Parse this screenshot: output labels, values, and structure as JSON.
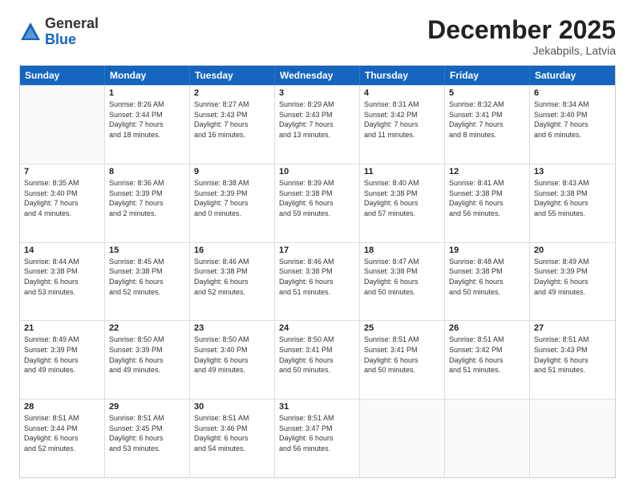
{
  "logo": {
    "general": "General",
    "blue": "Blue"
  },
  "title": "December 2025",
  "location": "Jekabpils, Latvia",
  "weekdays": [
    "Sunday",
    "Monday",
    "Tuesday",
    "Wednesday",
    "Thursday",
    "Friday",
    "Saturday"
  ],
  "rows": [
    [
      {
        "day": "",
        "lines": []
      },
      {
        "day": "1",
        "lines": [
          "Sunrise: 8:26 AM",
          "Sunset: 3:44 PM",
          "Daylight: 7 hours",
          "and 18 minutes."
        ]
      },
      {
        "day": "2",
        "lines": [
          "Sunrise: 8:27 AM",
          "Sunset: 3:43 PM",
          "Daylight: 7 hours",
          "and 16 minutes."
        ]
      },
      {
        "day": "3",
        "lines": [
          "Sunrise: 8:29 AM",
          "Sunset: 3:43 PM",
          "Daylight: 7 hours",
          "and 13 minutes."
        ]
      },
      {
        "day": "4",
        "lines": [
          "Sunrise: 8:31 AM",
          "Sunset: 3:42 PM",
          "Daylight: 7 hours",
          "and 11 minutes."
        ]
      },
      {
        "day": "5",
        "lines": [
          "Sunrise: 8:32 AM",
          "Sunset: 3:41 PM",
          "Daylight: 7 hours",
          "and 8 minutes."
        ]
      },
      {
        "day": "6",
        "lines": [
          "Sunrise: 8:34 AM",
          "Sunset: 3:40 PM",
          "Daylight: 7 hours",
          "and 6 minutes."
        ]
      }
    ],
    [
      {
        "day": "7",
        "lines": [
          "Sunrise: 8:35 AM",
          "Sunset: 3:40 PM",
          "Daylight: 7 hours",
          "and 4 minutes."
        ]
      },
      {
        "day": "8",
        "lines": [
          "Sunrise: 8:36 AM",
          "Sunset: 3:39 PM",
          "Daylight: 7 hours",
          "and 2 minutes."
        ]
      },
      {
        "day": "9",
        "lines": [
          "Sunrise: 8:38 AM",
          "Sunset: 3:39 PM",
          "Daylight: 7 hours",
          "and 0 minutes."
        ]
      },
      {
        "day": "10",
        "lines": [
          "Sunrise: 8:39 AM",
          "Sunset: 3:38 PM",
          "Daylight: 6 hours",
          "and 59 minutes."
        ]
      },
      {
        "day": "11",
        "lines": [
          "Sunrise: 8:40 AM",
          "Sunset: 3:38 PM",
          "Daylight: 6 hours",
          "and 57 minutes."
        ]
      },
      {
        "day": "12",
        "lines": [
          "Sunrise: 8:41 AM",
          "Sunset: 3:38 PM",
          "Daylight: 6 hours",
          "and 56 minutes."
        ]
      },
      {
        "day": "13",
        "lines": [
          "Sunrise: 8:43 AM",
          "Sunset: 3:38 PM",
          "Daylight: 6 hours",
          "and 55 minutes."
        ]
      }
    ],
    [
      {
        "day": "14",
        "lines": [
          "Sunrise: 8:44 AM",
          "Sunset: 3:38 PM",
          "Daylight: 6 hours",
          "and 53 minutes."
        ]
      },
      {
        "day": "15",
        "lines": [
          "Sunrise: 8:45 AM",
          "Sunset: 3:38 PM",
          "Daylight: 6 hours",
          "and 52 minutes."
        ]
      },
      {
        "day": "16",
        "lines": [
          "Sunrise: 8:46 AM",
          "Sunset: 3:38 PM",
          "Daylight: 6 hours",
          "and 52 minutes."
        ]
      },
      {
        "day": "17",
        "lines": [
          "Sunrise: 8:46 AM",
          "Sunset: 3:38 PM",
          "Daylight: 6 hours",
          "and 51 minutes."
        ]
      },
      {
        "day": "18",
        "lines": [
          "Sunrise: 8:47 AM",
          "Sunset: 3:38 PM",
          "Daylight: 6 hours",
          "and 50 minutes."
        ]
      },
      {
        "day": "19",
        "lines": [
          "Sunrise: 8:48 AM",
          "Sunset: 3:38 PM",
          "Daylight: 6 hours",
          "and 50 minutes."
        ]
      },
      {
        "day": "20",
        "lines": [
          "Sunrise: 8:49 AM",
          "Sunset: 3:39 PM",
          "Daylight: 6 hours",
          "and 49 minutes."
        ]
      }
    ],
    [
      {
        "day": "21",
        "lines": [
          "Sunrise: 8:49 AM",
          "Sunset: 3:39 PM",
          "Daylight: 6 hours",
          "and 49 minutes."
        ]
      },
      {
        "day": "22",
        "lines": [
          "Sunrise: 8:50 AM",
          "Sunset: 3:39 PM",
          "Daylight: 6 hours",
          "and 49 minutes."
        ]
      },
      {
        "day": "23",
        "lines": [
          "Sunrise: 8:50 AM",
          "Sunset: 3:40 PM",
          "Daylight: 6 hours",
          "and 49 minutes."
        ]
      },
      {
        "day": "24",
        "lines": [
          "Sunrise: 8:50 AM",
          "Sunset: 3:41 PM",
          "Daylight: 6 hours",
          "and 50 minutes."
        ]
      },
      {
        "day": "25",
        "lines": [
          "Sunrise: 8:51 AM",
          "Sunset: 3:41 PM",
          "Daylight: 6 hours",
          "and 50 minutes."
        ]
      },
      {
        "day": "26",
        "lines": [
          "Sunrise: 8:51 AM",
          "Sunset: 3:42 PM",
          "Daylight: 6 hours",
          "and 51 minutes."
        ]
      },
      {
        "day": "27",
        "lines": [
          "Sunrise: 8:51 AM",
          "Sunset: 3:43 PM",
          "Daylight: 6 hours",
          "and 51 minutes."
        ]
      }
    ],
    [
      {
        "day": "28",
        "lines": [
          "Sunrise: 8:51 AM",
          "Sunset: 3:44 PM",
          "Daylight: 6 hours",
          "and 52 minutes."
        ]
      },
      {
        "day": "29",
        "lines": [
          "Sunrise: 8:51 AM",
          "Sunset: 3:45 PM",
          "Daylight: 6 hours",
          "and 53 minutes."
        ]
      },
      {
        "day": "30",
        "lines": [
          "Sunrise: 8:51 AM",
          "Sunset: 3:46 PM",
          "Daylight: 6 hours",
          "and 54 minutes."
        ]
      },
      {
        "day": "31",
        "lines": [
          "Sunrise: 8:51 AM",
          "Sunset: 3:47 PM",
          "Daylight: 6 hours",
          "and 56 minutes."
        ]
      },
      {
        "day": "",
        "lines": []
      },
      {
        "day": "",
        "lines": []
      },
      {
        "day": "",
        "lines": []
      }
    ]
  ]
}
